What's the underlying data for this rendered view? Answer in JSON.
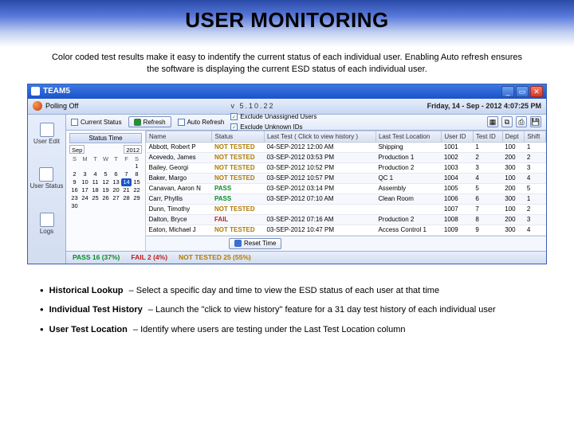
{
  "slide": {
    "title": "USER MONITORING",
    "intro": "Color coded test results make it easy to indentify the current status of each individual user. Enabling Auto refresh ensures the software is displaying the current ESD status of each individual user."
  },
  "window": {
    "title": "TEAM5",
    "polling": "Polling Off",
    "center_tag": "v 5.10.22",
    "datetime": "Friday, 14 - Sep - 2012   4:07:25 PM"
  },
  "rail": {
    "edit": "User\nEdit",
    "status": "User\nStatus",
    "logs": "Logs"
  },
  "toolbar": {
    "current_status": "Current Status",
    "refresh": "Refresh",
    "auto_refresh": "Auto Refresh",
    "exclude_unassigned": "Exclude Unassigned Users",
    "exclude_unknown": "Exclude Unknown IDs"
  },
  "calendar": {
    "header": "Status Time",
    "month": "Sep",
    "year": "2012",
    "dow": [
      "S",
      "M",
      "T",
      "W",
      "T",
      "F",
      "S"
    ],
    "days": [
      "",
      "",
      "",
      "",
      "",
      "",
      "1",
      "2",
      "3",
      "4",
      "5",
      "6",
      "7",
      "8",
      "9",
      "10",
      "11",
      "12",
      "13",
      "14",
      "15",
      "16",
      "17",
      "18",
      "19",
      "20",
      "21",
      "22",
      "23",
      "24",
      "25",
      "26",
      "27",
      "28",
      "29",
      "30",
      "",
      "",
      "",
      "",
      "",
      ""
    ],
    "selected": "14",
    "reset": "Reset Time"
  },
  "table": {
    "headers": [
      "Name",
      "Status",
      "Last Test\n( Click to view history )",
      "Last Test\nLocation",
      "User ID",
      "Test ID",
      "Dept",
      "Shift"
    ],
    "rows": [
      {
        "name": "Abbott, Robert P",
        "status": "NOT TESTED",
        "status_cls": "nottested",
        "last": "04-SEP-2012 12:00 AM",
        "loc": "Shipping",
        "uid": "1001",
        "tid": "1",
        "dept": "100",
        "shift": "1"
      },
      {
        "name": "Acevedo, James",
        "status": "NOT TESTED",
        "status_cls": "nottested",
        "last": "03-SEP-2012 03:53 PM",
        "loc": "Production 1",
        "uid": "1002",
        "tid": "2",
        "dept": "200",
        "shift": "2"
      },
      {
        "name": "Bailey, Georgi",
        "status": "NOT TESTED",
        "status_cls": "nottested",
        "last": "03-SEP-2012 10:52 PM",
        "loc": "Production 2",
        "uid": "1003",
        "tid": "3",
        "dept": "300",
        "shift": "3"
      },
      {
        "name": "Baker, Margo",
        "status": "NOT TESTED",
        "status_cls": "nottested",
        "last": "03-SEP-2012 10:57 PM",
        "loc": "QC 1",
        "uid": "1004",
        "tid": "4",
        "dept": "100",
        "shift": "4"
      },
      {
        "name": "Canavan, Aaron N",
        "status": "PASS",
        "status_cls": "pass",
        "last": "03-SEP-2012 03:14 PM",
        "loc": "Assembly",
        "uid": "1005",
        "tid": "5",
        "dept": "200",
        "shift": "5"
      },
      {
        "name": "Carr, Phyllis",
        "status": "PASS",
        "status_cls": "pass",
        "last": "03-SEP-2012 07:10 AM",
        "loc": "Clean Room",
        "uid": "1006",
        "tid": "6",
        "dept": "300",
        "shift": "1"
      },
      {
        "name": "Dunn, Timothy",
        "status": "NOT TESTED",
        "status_cls": "nottested",
        "last": "",
        "loc": "",
        "uid": "1007",
        "tid": "7",
        "dept": "100",
        "shift": "2"
      },
      {
        "name": "Dalton, Bryce",
        "status": "FAIL",
        "status_cls": "fail",
        "last": "03-SEP-2012 07:16 AM",
        "loc": "Production 2",
        "uid": "1008",
        "tid": "8",
        "dept": "200",
        "shift": "3"
      },
      {
        "name": "Eaton, Michael J",
        "status": "NOT TESTED",
        "status_cls": "nottested",
        "last": "03-SEP-2012 10:47 PM",
        "loc": "Access Control 1",
        "uid": "1009",
        "tid": "9",
        "dept": "300",
        "shift": "4"
      }
    ]
  },
  "summary": {
    "pass": "PASS 16 (37%)",
    "fail": "FAIL 2 (4%)",
    "not": "NOT TESTED 25 (55%)"
  },
  "bullets": {
    "b1_label": "Historical Lookup",
    "b1_text": " –  Select a specific day and time to view the ESD status of each user at that time",
    "b2_label": "Individual Test History",
    "b2_text": " – Launch the \"click to view history\" feature for a 31 day test history of each individual user",
    "b3_label": "User Test Location",
    "b3_text": " – Identify where users are testing under the Last Test Location column"
  }
}
